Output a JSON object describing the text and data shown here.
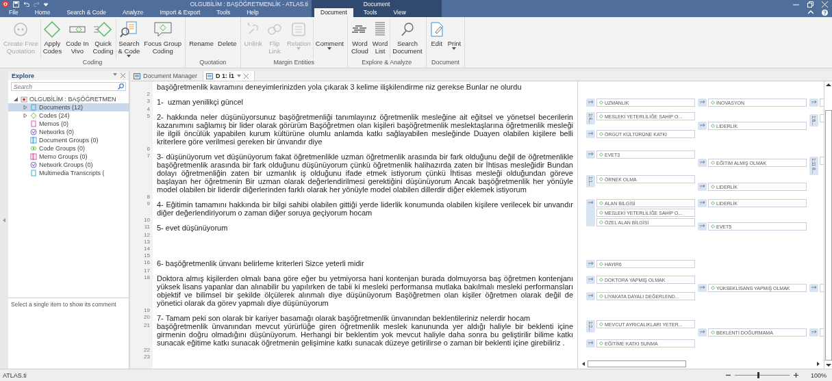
{
  "title_bar": {
    "title": "OLGUBİLİM : BAŞÖĞRETMENLİK - ATLAS.ti",
    "context_label": "Document"
  },
  "menu_tabs": [
    {
      "label": "File",
      "selected": false
    },
    {
      "label": "Home",
      "selected": false
    },
    {
      "label": "Search & Code",
      "selected": false
    },
    {
      "label": "Analyze",
      "selected": false
    },
    {
      "label": "Import & Export",
      "selected": false
    },
    {
      "label": "Tools",
      "selected": false
    },
    {
      "label": "Help",
      "selected": false
    }
  ],
  "context_tabs": [
    {
      "label": "Document",
      "selected": true
    },
    {
      "label": "Tools",
      "selected": false
    },
    {
      "label": "View",
      "selected": false
    }
  ],
  "ribbon": {
    "groups": [
      {
        "label": "Coding",
        "sections": [
          {
            "buttons": [
              {
                "label": "Create Free\nQuotation",
                "disabled": true,
                "dropdown": false
              }
            ]
          },
          {
            "buttons": [
              {
                "label": "Apply\nCodes",
                "disabled": false,
                "dropdown": false
              },
              {
                "label": "Code In\nVivo",
                "disabled": false,
                "dropdown": false
              },
              {
                "label": "Quick\nCoding",
                "disabled": false,
                "dropdown": false
              }
            ]
          },
          {
            "buttons": [
              {
                "label": "Search\n& Code",
                "disabled": false,
                "dropdown": true
              },
              {
                "label": "Focus Group\nCoding",
                "disabled": false,
                "dropdown": false
              }
            ]
          }
        ]
      },
      {
        "label": "Quotation",
        "sections": [
          {
            "buttons": [
              {
                "label": "Rename",
                "disabled": false,
                "dropdown": false
              },
              {
                "label": "Delete",
                "disabled": false,
                "dropdown": false
              }
            ]
          }
        ]
      },
      {
        "label": "Margin Entities",
        "sections": [
          {
            "buttons": [
              {
                "label": "Unlink",
                "disabled": true,
                "dropdown": false
              },
              {
                "label": "Flip\nLink",
                "disabled": true,
                "dropdown": false
              },
              {
                "label": "Relation",
                "disabled": true,
                "dropdown": true
              }
            ]
          },
          {
            "buttons": [
              {
                "label": "Comment",
                "disabled": false,
                "dropdown": true
              }
            ]
          }
        ]
      },
      {
        "label": "Explore & Analyze",
        "sections": [
          {
            "buttons": [
              {
                "label": "Word\nCloud",
                "disabled": false,
                "dropdown": false
              },
              {
                "label": "Word\nList",
                "disabled": false,
                "dropdown": false
              }
            ]
          },
          {
            "buttons": [
              {
                "label": "Search\nDocument",
                "disabled": false,
                "dropdown": false
              }
            ]
          }
        ]
      },
      {
        "label": "Document",
        "sections": [
          {
            "buttons": [
              {
                "label": "Edit",
                "disabled": false,
                "dropdown": false
              },
              {
                "label": "Print",
                "disabled": false,
                "dropdown": true
              }
            ]
          }
        ]
      }
    ]
  },
  "sidebar": {
    "title": "Explore",
    "search": {
      "placeholder": "Search"
    },
    "tree": [
      {
        "label": "OLGUBİLİM : BAŞÖĞRETMEN",
        "kind": "project",
        "selected": false,
        "expanded": true,
        "children": [
          {
            "label": "Documents (12)",
            "kind": "document",
            "selected": true,
            "expanded": false
          },
          {
            "label": "Codes (24)",
            "kind": "code",
            "selected": false,
            "expanded": false
          },
          {
            "label": "Memos (0)",
            "kind": "memo",
            "selected": false
          },
          {
            "label": "Networks (0)",
            "kind": "network",
            "selected": false
          },
          {
            "label": "Document Groups (0)",
            "kind": "document-group",
            "selected": false
          },
          {
            "label": "Code Groups (0)",
            "kind": "code-group",
            "selected": false
          },
          {
            "label": "Memo Groups (0)",
            "kind": "memo-group",
            "selected": false
          },
          {
            "label": "Network Groups (0)",
            "kind": "network-group",
            "selected": false
          },
          {
            "label": "Multimedia Transcripts (",
            "kind": "document",
            "selected": false
          }
        ]
      }
    ],
    "comment_hint": "Select a single item to show its comment"
  },
  "doc_tabs": [
    {
      "label": "Document Manager",
      "selected": false
    },
    {
      "label": "D 1: İ1",
      "selected": true
    }
  ],
  "document": {
    "rows": [
      {
        "text": "başöğretmenlik kavramını deneyimlerinizden yola çıkarak 3 kelime ilişkilendirme niz gerekse Bunlar ne olurdu"
      },
      {
        "number": "2"
      },
      {
        "number": "3",
        "text": "1-  uzman yenilikçi güncel"
      },
      {
        "number": "4"
      },
      {
        "number": "5",
        "text": "2- hakkında neler düşünüyorsunuz başöğretmenliği tanımlayınız öğretmenlik mesleğine ait eğitsel ve yönetsel becerilerin kazanımını sağlamış bir lider olarak görürüm Başöğretmen olan kişileri başöğretmenlik meslektaşlarına öğretmenlik mesleği ile ilgili öncülük yapabilen kurum kültürüne olumlu anlamda katkı sağlayabilen mesleğinde Duayen olabilen kişilere belli kriterlere göre verilmesi gereken bir ünvandır diye"
      },
      {
        "number": "6"
      },
      {
        "number": "7",
        "text": "3- düşünüyorum vet düşünüyorum fakat öğretmenlikle uzman öğretmenlik arasında bir fark olduğunu değil de öğretmenlikle başöğretmenlik arasında bir fark olduğunu düşünüyorum çünkü öğretmenlik halihazırda zaten bir İhtisas mesleğidir Bundan dolayı öğretmenliğin zaten bir uzmanlık iş olduğunu ifade etmek istiyorum çünkü İhtisas mesleği olduğundan göreve başlayan her öğretmenin Bir uzman olarak değerlendirilmesi gerektiğini düşünüyorum Ancak başöğretmenlik her yönüyle model olabilen bir liderdir diğerlerinden farklı olarak her yönüyle model olabilen dillerdir diğer eklemek istiyorum"
      },
      {
        "number": "8"
      },
      {
        "number": "9",
        "text": "4- Eğitimin tamamını hakkında bir bilgi sahibi olabilen gittiği yerde liderlik konumunda olabilen kişilere verilecek bir unvandır diğer değerlendiriyorum o zaman diğer soruya geçiyorum hocam"
      },
      {
        "number": "10"
      },
      {
        "number": "11",
        "text": "5- evet düşünüyorum"
      },
      {
        "number": "12"
      },
      {
        "number": "13"
      },
      {
        "number": "14"
      },
      {
        "number": "15"
      },
      {
        "number": "16",
        "text": "6- başöğretmenlik ünvanı belirleme kriterleri Sizce yeterli midir"
      },
      {
        "number": "17"
      },
      {
        "number": "18",
        "text": "Doktora almış kişilerden olmalı bana göre eğer bu yetmiyorsa hani kontenjan burada dolmuyorsa baş öğretmen kontenjanı yüksek lisans yapanlar dan alınabilir bu yapılırken de tabii ki mesleki performansa mutlaka bakılmalı mesleki performansları objektif ve bilimsel bir şekilde ölçülerek alınmalı diye düşünüyorum Başöğretmen olan kişiler öğretmen olarak değil de yönetici olarak da görev yapmalı diye düşünüyorum"
      },
      {
        "number": "19"
      },
      {
        "number": "20",
        "text": "7- Tamam peki son olarak bir kariyer basamağı olarak başöğretmenlik ünvanından beklentileriniz nelerdir hocam"
      },
      {
        "number": "21",
        "text": "başöğretmenlik ünvanından mevcut yürürlüğe giren öğretmenlik meslek kanununda yer aldığı haliyle bir beklenti içine girmenin doğru olmadığını düşünüyorum. Herhangi bir beklentim yok mevcut haliyle daha sonra bu geliştirilir bilime katkı sunacak eğitime katkı sunacak öğretmenin gelişimine katkı sunacak düzeye getirilirse o zaman bir beklenti içine girebiliriz ."
      },
      {
        "number": "22"
      },
      {
        "number": "23"
      }
    ]
  },
  "margin": {
    "columns": [
      {
        "entries": [
          {
            "kind": "single",
            "codes": [
              "UZMANLIK"
            ]
          },
          {
            "kind": "bracket",
            "label": "1:4...",
            "codes": [
              "MESLEKİ YETERLİLİĞE SAHİP O..."
            ]
          },
          {
            "kind": "single",
            "codes": [
              "ÖRGÜT KÜLTÜRÜNE KATKI"
            ]
          },
          {
            "kind": "single",
            "codes": [
              "EVET3"
            ]
          },
          {
            "kind": "bracket",
            "label": "1:1...",
            "codes": [
              "ÖRNEK OLMA"
            ]
          },
          {
            "kind": "single",
            "codes": [
              "ALAN BİLGİSİ",
              "MESLEKİ YETERLİLİĞE SAHİP O...",
              "ÖZEL ALAN BİLGİSİ"
            ]
          },
          {
            "kind": "single",
            "codes": [
              "HAYIR6"
            ]
          },
          {
            "kind": "single",
            "codes": [
              "DOKTORA YAPMIŞ OLMAK"
            ]
          },
          {
            "kind": "single",
            "codes": [
              "LİYAKATA DAYALI DEĞERLEND..."
            ]
          },
          {
            "kind": "bracket",
            "label": "1:2...",
            "codes": [
              "MEVCUT AYRICALIKLARI YETER..."
            ]
          },
          {
            "kind": "single",
            "codes": [
              "EĞİTİME KATKI SUNMA"
            ]
          }
        ]
      },
      {
        "entries": [
          {
            "kind": "single",
            "codes": [
              "İNOVASYON"
            ]
          },
          {
            "kind": "single",
            "codes": [
              "LİDERLİK"
            ]
          },
          {
            "kind": "single",
            "codes": [
              "EĞİTİM ALMIŞ OLMAK"
            ]
          },
          {
            "kind": "single",
            "codes": [
              "LİDERLİK"
            ]
          },
          {
            "kind": "single",
            "codes": [
              "LİDERLİK"
            ]
          },
          {
            "kind": "single",
            "codes": [
              "EVET5"
            ]
          },
          {
            "kind": "single",
            "codes": [
              "YÜKSEKLİSANS YAPMIŞ OLMAK"
            ]
          },
          {
            "kind": "single",
            "codes": [
              "BEKLENTİ DOĞURMAMA"
            ]
          }
        ]
      },
      {
        "entries": [
          {
            "kind": "single"
          },
          {
            "kind": "bracket",
            "label": "1:6..."
          },
          {
            "kind": "bracket",
            "label": "1:11 8..."
          },
          {
            "kind": "single"
          },
          {
            "kind": "single"
          }
        ]
      }
    ]
  },
  "status_bar": {
    "text": "ATLAS.ti",
    "zoom": {
      "level": 0.42,
      "reading": "100%"
    }
  }
}
